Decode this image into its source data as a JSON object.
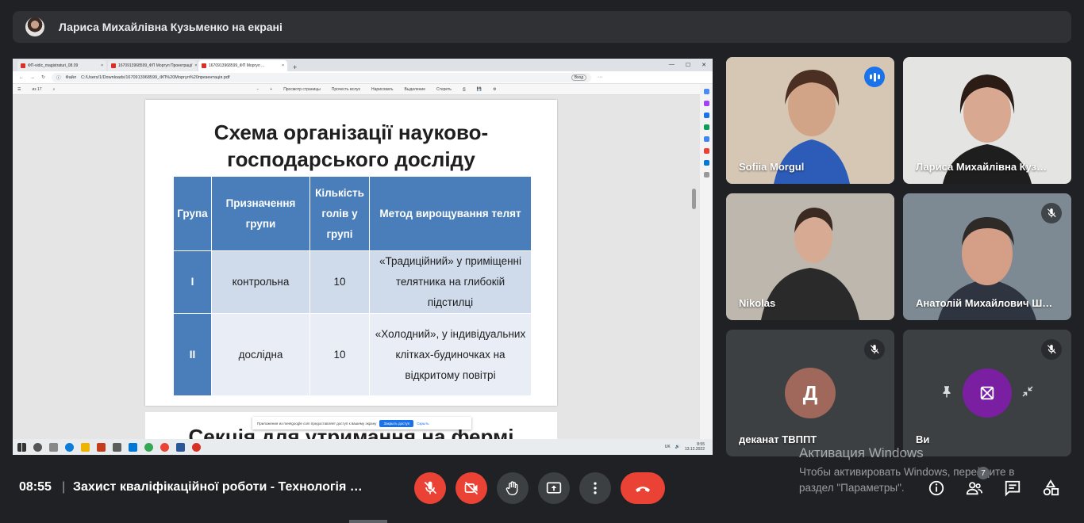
{
  "presenter": {
    "name": "Лариса Михайлівна Кузьменко на екрані"
  },
  "browser": {
    "tabs": [
      {
        "label": "ФП-vidic_magistraturi_08.09"
      },
      {
        "label": "1670913968599_ФП Моргул Проектрації"
      },
      {
        "label": "1670913968599_ФП Моргул ..."
      }
    ],
    "address": "C:/Users/1/Downloads/1670913968599_ФП%20Моргул%20презентація.pdf",
    "address_prefix": "Файл",
    "profile": "Вход",
    "pdf_toolbar": {
      "page": "из 17",
      "page_view": "Просмотр страницы",
      "read_aloud": "Прочесть вслух",
      "draw": "Нарисовать",
      "highlight": "Выделение",
      "erase": "Стереть"
    },
    "notification": {
      "text": "Приложения из meetgoogle com предоставляет доступ к вашему экрану",
      "stop": "Закрыть доступ",
      "hide": "Скрыть"
    },
    "taskbar": {
      "lang": "UK",
      "time": "8:55",
      "date": "13.12.2022"
    }
  },
  "slide": {
    "title_line1": "Схема організації науково-",
    "title_line2": "господарського досліду",
    "headers": [
      "Група",
      "Призначення групи",
      "Кількість голів у групі",
      "Метод вирощування телят"
    ],
    "rows": [
      {
        "group": "I",
        "purpose": "контрольна",
        "count": "10",
        "method": "«Традиційний» у приміщенні телятника на глибокій підстилці"
      },
      {
        "group": "II",
        "purpose": "дослідна",
        "count": "10",
        "method": "«Холодний», у індивідуальних клітках-будиночках на відкритому повітрі"
      }
    ],
    "next_title": "Секція для утримання на фермі"
  },
  "participants": [
    {
      "name": "Sofiia Morgul",
      "speaking": true
    },
    {
      "name": "Лариса Михайлівна Куз…"
    },
    {
      "name": "Nikolas"
    },
    {
      "name": "Анатолій Михайлович Ш…",
      "muted": true
    },
    {
      "name": "деканат ТВППТ",
      "initial": "Д",
      "muted": true,
      "color": "#a0685a"
    },
    {
      "name": "Ви",
      "muted": true
    }
  ],
  "meeting": {
    "time": "08:55",
    "separator": "|",
    "title": "Захист кваліфікаційної роботи - Технологія …",
    "people_count": "7"
  },
  "windows_activation": {
    "line1": "Активация Windows",
    "line2": "Чтобы активировать Windows, перейдите в",
    "line3": "раздел \"Параметры\"."
  },
  "colors": {
    "meet_bg": "#202124",
    "tile_bg": "#3c4043",
    "danger": "#ea4335",
    "speaking": "#8ab4f8",
    "slide_header": "#4a7ebb"
  }
}
